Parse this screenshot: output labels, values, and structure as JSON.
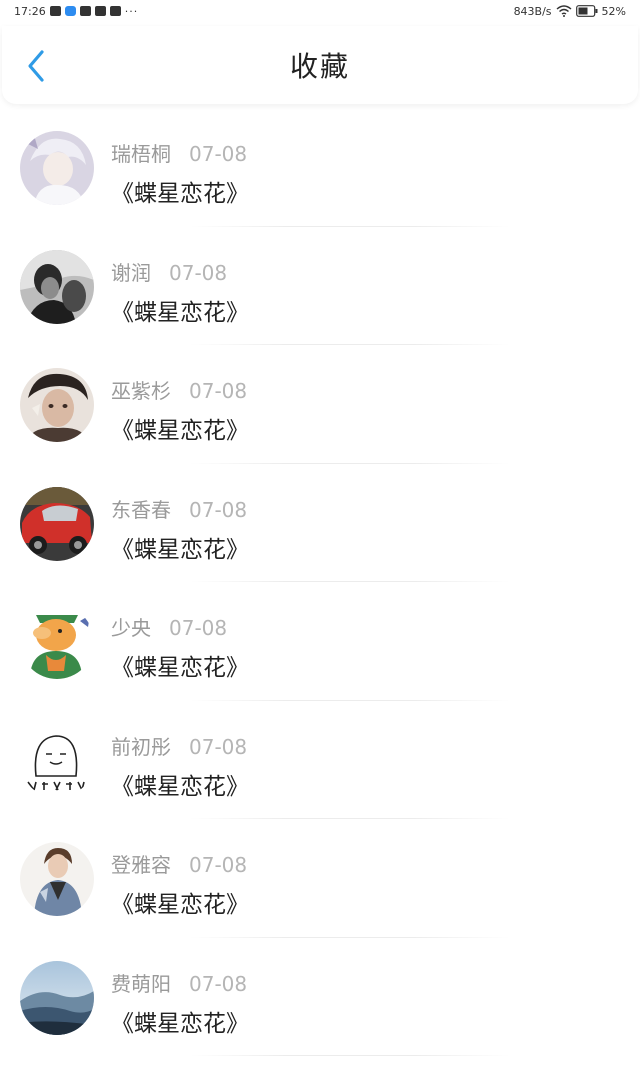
{
  "status_bar": {
    "time": "17:26",
    "dots": "···",
    "speed": "843B/s",
    "battery": "52%"
  },
  "header": {
    "title": "收藏",
    "back_icon": "chevron-left-icon"
  },
  "items": [
    {
      "name": "瑞梧桐",
      "date": "07-08",
      "title": "《蝶星恋花》",
      "avatar_icon": "anime-boy-avatar",
      "avatar_color": "#c9c4d6"
    },
    {
      "name": "谢润",
      "date": "07-08",
      "title": "《蝶星恋花》",
      "avatar_icon": "bw-couple-avatar",
      "avatar_color": "#6b6b6b"
    },
    {
      "name": "巫紫杉",
      "date": "07-08",
      "title": "《蝶星恋花》",
      "avatar_icon": "illustrated-boy-avatar",
      "avatar_color": "#8a6f62"
    },
    {
      "name": "东香春",
      "date": "07-08",
      "title": "《蝶星恋花》",
      "avatar_icon": "red-car-avatar",
      "avatar_color": "#c23a30"
    },
    {
      "name": "少央",
      "date": "07-08",
      "title": "《蝶星恋花》",
      "avatar_icon": "cartoon-pig-avatar",
      "avatar_color": "#f1a64a"
    },
    {
      "name": "前初彤",
      "date": "07-08",
      "title": "《蝶星恋花》",
      "avatar_icon": "doodle-sticker-avatar",
      "avatar_color": "#ffffff"
    },
    {
      "name": "登雅容",
      "date": "07-08",
      "title": "《蝶星恋花》",
      "avatar_icon": "girl-denim-avatar",
      "avatar_color": "#7c8ea8"
    },
    {
      "name": "费萌阳",
      "date": "07-08",
      "title": "《蝶星恋花》",
      "avatar_icon": "mountain-landscape-avatar",
      "avatar_color": "#5d7a94"
    }
  ]
}
